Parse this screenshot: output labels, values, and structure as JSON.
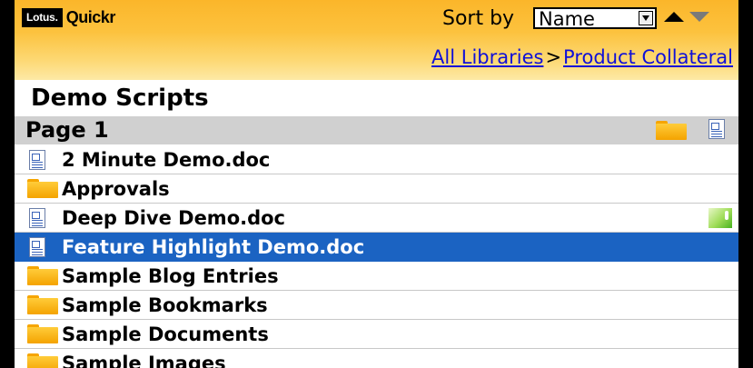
{
  "app": {
    "logo_brand": "Lotus.",
    "logo_product": "Quickr"
  },
  "sort": {
    "label": "Sort by",
    "value": "Name"
  },
  "breadcrumb": {
    "root": "All Libraries",
    "separator": ">",
    "current": "Product Collateral"
  },
  "title": "Demo Scripts",
  "page_label": "Page 1",
  "items": [
    {
      "type": "document",
      "name": "2 Minute Demo.doc",
      "selected": false
    },
    {
      "type": "folder",
      "name": "Approvals",
      "selected": false
    },
    {
      "type": "document",
      "name": "Deep Dive Demo.doc",
      "selected": false,
      "status_icon": "checked-out-icon"
    },
    {
      "type": "document",
      "name": "Feature Highlight Demo.doc",
      "selected": true
    },
    {
      "type": "folder",
      "name": "Sample Blog Entries",
      "selected": false
    },
    {
      "type": "folder",
      "name": "Sample Bookmarks",
      "selected": false
    },
    {
      "type": "folder",
      "name": "Sample Documents",
      "selected": false
    },
    {
      "type": "folder",
      "name": "Sample Images",
      "selected": false
    }
  ],
  "colors": {
    "header": "#fcc23e",
    "selection": "#1b63c2",
    "link": "#1010d8"
  }
}
